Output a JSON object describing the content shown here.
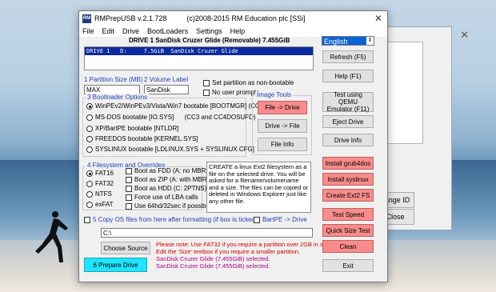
{
  "background_window": {
    "buttons": [
      "hange ID",
      "Close"
    ]
  },
  "window": {
    "app_icon": "RM",
    "title": "RMPrepUSB v.2.1.728          (c)2008-2015 RM Education plc [SSi]",
    "close": "✕"
  },
  "menu": [
    "File",
    "Edit",
    "Drive",
    "BootLoaders",
    "Settings",
    "Help"
  ],
  "drive_header": "DRIVE 1 SanDisk Cruzer Glide  (Removable) 7.455GiB",
  "drive_list": [
    "DRIVE 1   D:     7.5GiB  SanDisk Cruzer Glide"
  ],
  "language": "English",
  "language_spin": "⇕",
  "partition": {
    "size_label": "1 Partition Size (MB)",
    "size_value": "MAX",
    "volume_label": "2 Volume Label",
    "volume_value": "SanDisk",
    "non_bootable": "Set partition as non-bootable",
    "no_prompts": "No user prompts"
  },
  "bootloader": {
    "label": "3 Bootloader Options",
    "options": [
      "WinPEv2/WinPEv3/Vista/Win7 bootable [BOOTMGR] (CC4)",
      "MS-DOS bootable [IO.SYS]      (CC3 and CC4DOSUFD)",
      "XP/BartPE bootable [NTLDR]",
      "FREEDOS bootable [KERNEL.SYS]",
      "SYSLINUX bootable [LDLINUX.SYS + SYSLINUX.CFG]"
    ]
  },
  "image_tools": {
    "label": "Image Tools",
    "file_to_drive": "File -> Drive",
    "drive_to_file": "Drive -> File",
    "file_info": "File Info"
  },
  "filesystem": {
    "label": "4 Filesystem and Overrides",
    "fs": [
      "FAT16",
      "FAT32",
      "NTFS",
      "exFAT"
    ],
    "overrides": [
      "Boot as FDD (A: no MBR)",
      "Boot as ZIP (A: with MBR)",
      "Boot as HDD (C: 2PTNS)",
      "Force use of LBA calls",
      "Use 64hd/32sec if possible"
    ]
  },
  "info_text": "CREATE a linux Ext2 filesystem as a file on the selected drive. You will be asked for a filename/volumename and a size. The files can be copied or deleted in Windows Explorer just like any other file.",
  "copy_os": {
    "label": "5 Copy OS files from here after formatting (if box is ticked)",
    "bartpe": "BartPE -> Drive",
    "path": "C:\\",
    "choose": "Choose Source"
  },
  "notes": [
    "Please note: Use FAT32 if you require a partition over 2GB in size.",
    "Edit the 'Size' textbox if you require a smaller partition.",
    "SanDisk Cruzer Glide (7.455GiB) selected.",
    "SanDisk Cruzer Glide (7.455GiB) selected."
  ],
  "prepare": "6 Prepare Drive",
  "right_buttons": {
    "refresh": "Refresh (F5)",
    "help": "Help (F1)",
    "test_qemu_1": "Test using QEMU",
    "test_qemu_2": "Emulator (F11)",
    "eject": "Eject Drive",
    "drive_info": "Drive Info",
    "install_grub": "Install grub4dos",
    "install_syslinux": "Install syslinux",
    "create_ext2": "Create Ext2 FS",
    "test_speed": "Test Speed",
    "quick_size": "Quick Size Test",
    "clean": "Clean",
    "exit": "Exit"
  },
  "colors": {
    "selection_blue": "#0a2a9e",
    "red_button": "#f88b8b",
    "cyan_button": "#1fe5ff",
    "label_blue": "#1f3fb0"
  }
}
